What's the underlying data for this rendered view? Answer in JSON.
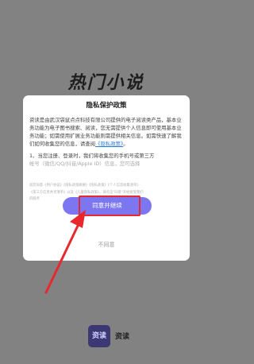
{
  "splash": {
    "title": "热门小说"
  },
  "dialog": {
    "title": "隐私保护政策",
    "para1_prefix": "资读是由武汉袋鼠点点科技有限公司提供的电子阅读类产品，基本业务功能为电子图书搜索、阅读，您无需提供个人信息即可使用基本业务功能；如需使用扩展业务功能则需提供相关信息。如需快速了解我们如何收集您的信息，请查阅",
    "policy_link": "《隐私政策》",
    "para1_suffix": "。",
    "para2_line1": "1、当您注册、登录时，我们将收集您的手机号或第三方",
    "para2_line2": "帐号（微信/QQ/抖音/Apple ID）信息，您可选择",
    "notice_lines": [
      "如您同意《用户协议》《隐私政策摘要》《隐私政策》《个人信息收集清单》",
      "《第三方信息共享清单》以及《儿童隐私政策》，请点击\"同意\"开始接受我们",
      "的服务"
    ],
    "agree_label": "同意并继续",
    "disagree_label": "不同意"
  },
  "footer": {
    "logo_text": "资读",
    "app_name": "资读"
  },
  "colors": {
    "accent": "#7c77f0",
    "highlight": "#e8282c",
    "overlay": "#828282"
  }
}
